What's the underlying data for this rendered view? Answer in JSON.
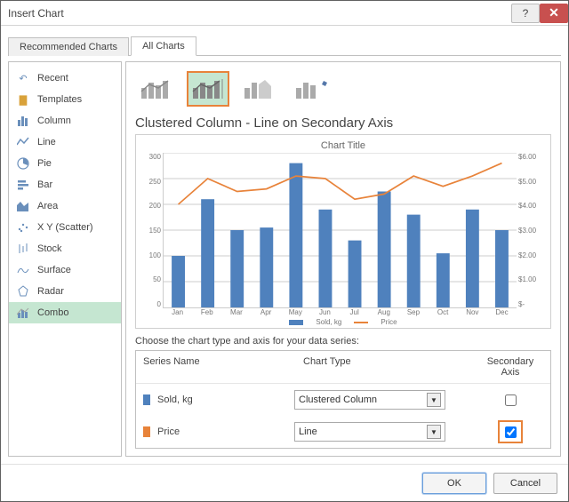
{
  "window": {
    "title": "Insert Chart"
  },
  "tabs": {
    "recommended": "Recommended Charts",
    "all": "All Charts"
  },
  "sidebar": {
    "items": [
      {
        "label": "Recent"
      },
      {
        "label": "Templates"
      },
      {
        "label": "Column"
      },
      {
        "label": "Line"
      },
      {
        "label": "Pie"
      },
      {
        "label": "Bar"
      },
      {
        "label": "Area"
      },
      {
        "label": "X Y (Scatter)"
      },
      {
        "label": "Stock"
      },
      {
        "label": "Surface"
      },
      {
        "label": "Radar"
      },
      {
        "label": "Combo"
      }
    ]
  },
  "main": {
    "heading": "Clustered Column - Line on Secondary Axis",
    "preview_title": "Chart Title",
    "legend": {
      "a": "Sold, kg",
      "b": "Price"
    },
    "choose_label": "Choose the chart type and axis for your data series:",
    "headers": {
      "name": "Series Name",
      "type": "Chart Type",
      "axis": "Secondary Axis"
    },
    "series": [
      {
        "name": "Sold, kg",
        "type": "Clustered Column"
      },
      {
        "name": "Price",
        "type": "Line"
      }
    ]
  },
  "buttons": {
    "ok": "OK",
    "cancel": "Cancel"
  },
  "chart_data": {
    "type": "combo",
    "categories": [
      "Jan",
      "Feb",
      "Mar",
      "Apr",
      "May",
      "Jun",
      "Jul",
      "Aug",
      "Sep",
      "Oct",
      "Nov",
      "Dec"
    ],
    "series": [
      {
        "name": "Sold, kg",
        "chart_type": "bar",
        "axis": "primary",
        "values": [
          100,
          210,
          150,
          155,
          280,
          190,
          130,
          225,
          180,
          105,
          190,
          150
        ]
      },
      {
        "name": "Price",
        "chart_type": "line",
        "axis": "secondary",
        "values": [
          4.0,
          5.0,
          4.5,
          4.6,
          5.1,
          5.0,
          4.2,
          4.4,
          5.1,
          4.7,
          5.1,
          5.6
        ]
      }
    ],
    "y1": {
      "min": 0,
      "max": 300,
      "step": 50,
      "label": ""
    },
    "y2": {
      "min": 0,
      "max": 6,
      "step": 1,
      "label": "",
      "format": "$0.00"
    },
    "title": "Chart Title",
    "xlabel": "",
    "legend_position": "bottom"
  }
}
